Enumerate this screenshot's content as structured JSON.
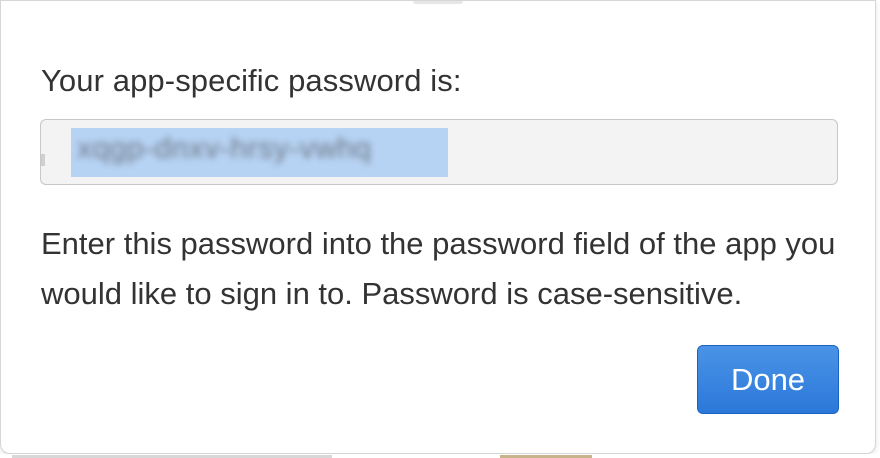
{
  "dialog": {
    "heading": "Your app-specific password is:",
    "password_value": "xqgp-dnxv-hrsy-vwhq",
    "description": "Enter this password into the password field of the app you would like to sign in to. Password is case-sensitive.",
    "done_label": "Done"
  },
  "colors": {
    "accent": "#2b78d9",
    "selection": "#b7d3f4",
    "text": "#333333",
    "field_background": "#f3f3f3"
  }
}
